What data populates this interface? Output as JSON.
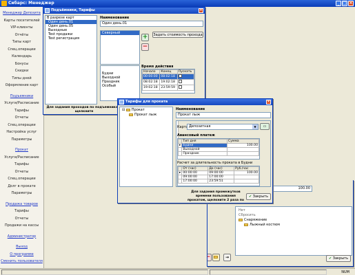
{
  "app": {
    "title": "Сибарс: Менеджер"
  },
  "sidebar": {
    "groups": [
      {
        "head": "Менеджер Депозита",
        "items": [
          "Карты посетителей",
          "VIP-клиенты",
          "Отчёты",
          "Типы карт",
          "Спец.операции",
          "Календарь",
          "Бонусы",
          "Скидки",
          "Типы дней",
          "Оформление карт"
        ]
      },
      {
        "head": "Подъемники",
        "items": [
          "Услуги/Расписание",
          "Тарифы",
          "Отчеты",
          "Спец.операции",
          "Настройка услуг",
          "Параметры"
        ]
      },
      {
        "head": "Прокат",
        "items": [
          "Услуги/Расписание",
          "Тарифы",
          "Отчеты",
          "Спец.операции",
          "Долг в прокате",
          "Параметры"
        ]
      },
      {
        "head": "Продажа товаров",
        "items": [
          "Тарифы",
          "Отчеты",
          "Продажи на кассы"
        ]
      },
      {
        "head": "Администратор",
        "items": []
      }
    ],
    "footer": [
      "Выход",
      "О программе",
      "Сменить пользователя"
    ]
  },
  "status": {
    "num": "NUM"
  },
  "lifts_window": {
    "title": "Подъёмники, Тарифы",
    "card_list_title": "В разрезе карт",
    "cards": [
      "Один день.01",
      "Один день.05",
      "Выходные",
      "Test продажи",
      "Test регистрация"
    ],
    "name_label": "Наименование",
    "name_value": "Один день.01",
    "zones": [
      "Северный"
    ],
    "calc_button": "Задать стоимость прохода",
    "time_label": "Время действия",
    "days": [
      "Будни",
      "Выходной",
      "Праздник",
      "Особый"
    ],
    "time_headers": [
      "Начало",
      "Конец",
      "Пускать"
    ],
    "time_rows": [
      {
        "start": "00:00:00",
        "end": "08:02:18"
      },
      {
        "start": "08:02:18",
        "end": "19:02:18"
      },
      {
        "start": "19:02:18",
        "end": "23:59:59"
      }
    ],
    "hint": "Для задания проходов по подъемникам, щелкните"
  },
  "rental_window": {
    "title": "Тарифы для проката",
    "tree_root": "Прокат",
    "tree_child": "Прокат лыж",
    "name_label": "Наименование",
    "name_value": "Прокат лыж",
    "card_label": "Карта",
    "card_value": "Депозитная",
    "advance_label": "Авансовый платеж",
    "advance_headers": [
      "Тип дня",
      "Сумма"
    ],
    "advance_rows": [
      {
        "day": "Будни",
        "sum": "100.00"
      },
      {
        "day": "Выходной",
        "sum": ""
      },
      {
        "day": "Праздник",
        "sum": ""
      }
    ],
    "calc_label": "Расчет за длительность проката в Будни",
    "calc_headers": [
      "От (час)",
      "До (час)",
      "Руб./час"
    ],
    "calc_rows": [
      {
        "from": "00:00:00",
        "to": "09:00:00",
        "rate": "100.00"
      },
      {
        "from": "09:00:00",
        "to": "17:00:00",
        "rate": ""
      },
      {
        "from": "17:00:00",
        "to": "23:59:51",
        "rate": ""
      }
    ],
    "hint": "Для задания промежутков времени пользования прокатом, щелкните 2 раза по названию типа дня",
    "close_label": "Закрыть"
  },
  "sales_window": {
    "value": "100.00",
    "row2": "Нет",
    "row3": "Сбросить",
    "tree": [
      "Снаряжение",
      "Лыжный костюм"
    ],
    "close_label": "Закрыть"
  }
}
